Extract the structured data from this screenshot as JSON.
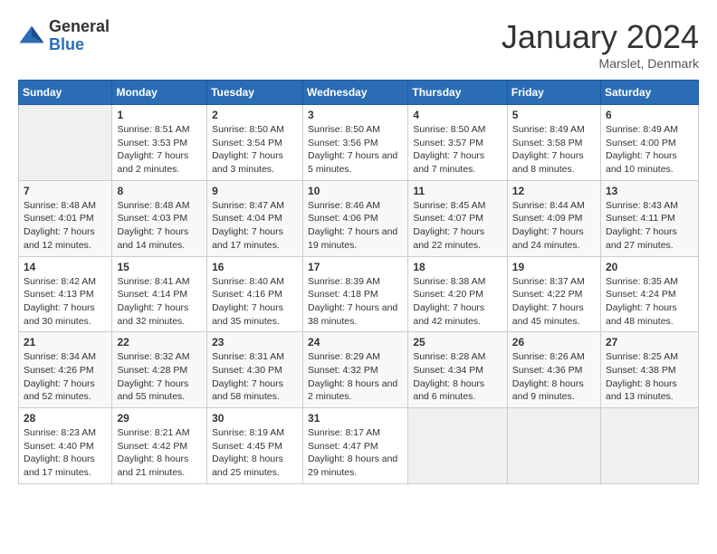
{
  "header": {
    "logo_general": "General",
    "logo_blue": "Blue",
    "month_year": "January 2024",
    "location": "Marslet, Denmark"
  },
  "columns": [
    "Sunday",
    "Monday",
    "Tuesday",
    "Wednesday",
    "Thursday",
    "Friday",
    "Saturday"
  ],
  "weeks": [
    [
      {
        "day": "",
        "sunrise": "",
        "sunset": "",
        "daylight": ""
      },
      {
        "day": "1",
        "sunrise": "Sunrise: 8:51 AM",
        "sunset": "Sunset: 3:53 PM",
        "daylight": "Daylight: 7 hours and 2 minutes."
      },
      {
        "day": "2",
        "sunrise": "Sunrise: 8:50 AM",
        "sunset": "Sunset: 3:54 PM",
        "daylight": "Daylight: 7 hours and 3 minutes."
      },
      {
        "day": "3",
        "sunrise": "Sunrise: 8:50 AM",
        "sunset": "Sunset: 3:56 PM",
        "daylight": "Daylight: 7 hours and 5 minutes."
      },
      {
        "day": "4",
        "sunrise": "Sunrise: 8:50 AM",
        "sunset": "Sunset: 3:57 PM",
        "daylight": "Daylight: 7 hours and 7 minutes."
      },
      {
        "day": "5",
        "sunrise": "Sunrise: 8:49 AM",
        "sunset": "Sunset: 3:58 PM",
        "daylight": "Daylight: 7 hours and 8 minutes."
      },
      {
        "day": "6",
        "sunrise": "Sunrise: 8:49 AM",
        "sunset": "Sunset: 4:00 PM",
        "daylight": "Daylight: 7 hours and 10 minutes."
      }
    ],
    [
      {
        "day": "7",
        "sunrise": "Sunrise: 8:48 AM",
        "sunset": "Sunset: 4:01 PM",
        "daylight": "Daylight: 7 hours and 12 minutes."
      },
      {
        "day": "8",
        "sunrise": "Sunrise: 8:48 AM",
        "sunset": "Sunset: 4:03 PM",
        "daylight": "Daylight: 7 hours and 14 minutes."
      },
      {
        "day": "9",
        "sunrise": "Sunrise: 8:47 AM",
        "sunset": "Sunset: 4:04 PM",
        "daylight": "Daylight: 7 hours and 17 minutes."
      },
      {
        "day": "10",
        "sunrise": "Sunrise: 8:46 AM",
        "sunset": "Sunset: 4:06 PM",
        "daylight": "Daylight: 7 hours and 19 minutes."
      },
      {
        "day": "11",
        "sunrise": "Sunrise: 8:45 AM",
        "sunset": "Sunset: 4:07 PM",
        "daylight": "Daylight: 7 hours and 22 minutes."
      },
      {
        "day": "12",
        "sunrise": "Sunrise: 8:44 AM",
        "sunset": "Sunset: 4:09 PM",
        "daylight": "Daylight: 7 hours and 24 minutes."
      },
      {
        "day": "13",
        "sunrise": "Sunrise: 8:43 AM",
        "sunset": "Sunset: 4:11 PM",
        "daylight": "Daylight: 7 hours and 27 minutes."
      }
    ],
    [
      {
        "day": "14",
        "sunrise": "Sunrise: 8:42 AM",
        "sunset": "Sunset: 4:13 PM",
        "daylight": "Daylight: 7 hours and 30 minutes."
      },
      {
        "day": "15",
        "sunrise": "Sunrise: 8:41 AM",
        "sunset": "Sunset: 4:14 PM",
        "daylight": "Daylight: 7 hours and 32 minutes."
      },
      {
        "day": "16",
        "sunrise": "Sunrise: 8:40 AM",
        "sunset": "Sunset: 4:16 PM",
        "daylight": "Daylight: 7 hours and 35 minutes."
      },
      {
        "day": "17",
        "sunrise": "Sunrise: 8:39 AM",
        "sunset": "Sunset: 4:18 PM",
        "daylight": "Daylight: 7 hours and 38 minutes."
      },
      {
        "day": "18",
        "sunrise": "Sunrise: 8:38 AM",
        "sunset": "Sunset: 4:20 PM",
        "daylight": "Daylight: 7 hours and 42 minutes."
      },
      {
        "day": "19",
        "sunrise": "Sunrise: 8:37 AM",
        "sunset": "Sunset: 4:22 PM",
        "daylight": "Daylight: 7 hours and 45 minutes."
      },
      {
        "day": "20",
        "sunrise": "Sunrise: 8:35 AM",
        "sunset": "Sunset: 4:24 PM",
        "daylight": "Daylight: 7 hours and 48 minutes."
      }
    ],
    [
      {
        "day": "21",
        "sunrise": "Sunrise: 8:34 AM",
        "sunset": "Sunset: 4:26 PM",
        "daylight": "Daylight: 7 hours and 52 minutes."
      },
      {
        "day": "22",
        "sunrise": "Sunrise: 8:32 AM",
        "sunset": "Sunset: 4:28 PM",
        "daylight": "Daylight: 7 hours and 55 minutes."
      },
      {
        "day": "23",
        "sunrise": "Sunrise: 8:31 AM",
        "sunset": "Sunset: 4:30 PM",
        "daylight": "Daylight: 7 hours and 58 minutes."
      },
      {
        "day": "24",
        "sunrise": "Sunrise: 8:29 AM",
        "sunset": "Sunset: 4:32 PM",
        "daylight": "Daylight: 8 hours and 2 minutes."
      },
      {
        "day": "25",
        "sunrise": "Sunrise: 8:28 AM",
        "sunset": "Sunset: 4:34 PM",
        "daylight": "Daylight: 8 hours and 6 minutes."
      },
      {
        "day": "26",
        "sunrise": "Sunrise: 8:26 AM",
        "sunset": "Sunset: 4:36 PM",
        "daylight": "Daylight: 8 hours and 9 minutes."
      },
      {
        "day": "27",
        "sunrise": "Sunrise: 8:25 AM",
        "sunset": "Sunset: 4:38 PM",
        "daylight": "Daylight: 8 hours and 13 minutes."
      }
    ],
    [
      {
        "day": "28",
        "sunrise": "Sunrise: 8:23 AM",
        "sunset": "Sunset: 4:40 PM",
        "daylight": "Daylight: 8 hours and 17 minutes."
      },
      {
        "day": "29",
        "sunrise": "Sunrise: 8:21 AM",
        "sunset": "Sunset: 4:42 PM",
        "daylight": "Daylight: 8 hours and 21 minutes."
      },
      {
        "day": "30",
        "sunrise": "Sunrise: 8:19 AM",
        "sunset": "Sunset: 4:45 PM",
        "daylight": "Daylight: 8 hours and 25 minutes."
      },
      {
        "day": "31",
        "sunrise": "Sunrise: 8:17 AM",
        "sunset": "Sunset: 4:47 PM",
        "daylight": "Daylight: 8 hours and 29 minutes."
      },
      {
        "day": "",
        "sunrise": "",
        "sunset": "",
        "daylight": ""
      },
      {
        "day": "",
        "sunrise": "",
        "sunset": "",
        "daylight": ""
      },
      {
        "day": "",
        "sunrise": "",
        "sunset": "",
        "daylight": ""
      }
    ]
  ]
}
